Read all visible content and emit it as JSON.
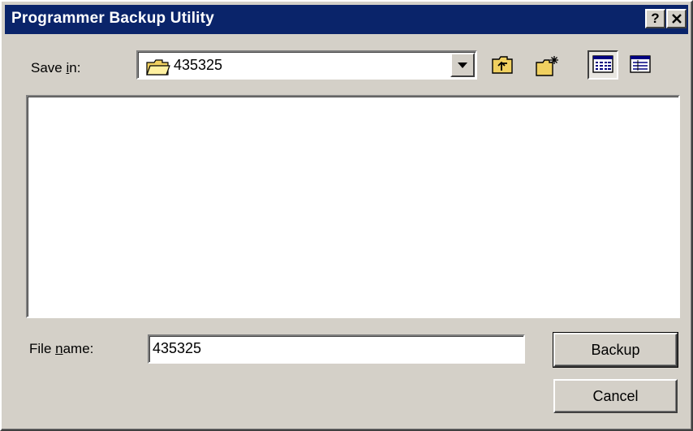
{
  "window": {
    "title": "Programmer Backup Utility",
    "help_label": "?",
    "close_label": "✕"
  },
  "save_in": {
    "label_pre": "Save ",
    "label_accel": "i",
    "label_post": "n:",
    "folder_value": "435325",
    "folder_icon": "folder-icon"
  },
  "toolbar": {
    "icons": [
      "up-one-level-icon",
      "create-new-folder-icon",
      "list-view-icon",
      "details-view-icon"
    ]
  },
  "file_name": {
    "label_pre": "File ",
    "label_accel": "n",
    "label_post": "ame:",
    "value": "435325"
  },
  "buttons": {
    "backup_label": "Backup",
    "cancel_label": "Cancel"
  },
  "colors": {
    "titlebar": "#0a246a",
    "face": "#d4d0c8",
    "folder": "#f0d060"
  }
}
